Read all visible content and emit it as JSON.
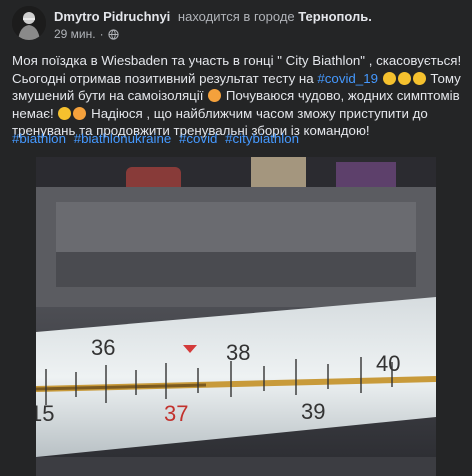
{
  "post": {
    "author": "Dmytro Pidruchnyi",
    "location_prefix": "находится в городе",
    "location_city": "Тернополь.",
    "timestamp": "29 мин.",
    "text_parts": [
      "Моя поїздка в Wiesbaden та участь в гонці \" City Biathlon\" , скасовується! Сьогодні отримав позитивний результат тесту на ",
      "#covid_19",
      " Тому змушений бути на самоізоляції ",
      " Почуваюся чудово, жодних симптомів немає! ",
      " Надіюся , що найближчим часом зможу приступити до тренувань та продовжити тренувальні збори із командою!"
    ],
    "hashtags": [
      "#biathlon",
      "#biathlonukraine",
      "#covid",
      "#citybiathlon"
    ]
  },
  "thermometer": {
    "top_scale": [
      "36",
      "38",
      "40"
    ],
    "bottom_scale": [
      "15",
      "37",
      "39"
    ]
  },
  "colors": {
    "background": "#242526",
    "text": "#e4e6eb",
    "secondary": "#b0b3b8",
    "link": "#4599ff"
  }
}
